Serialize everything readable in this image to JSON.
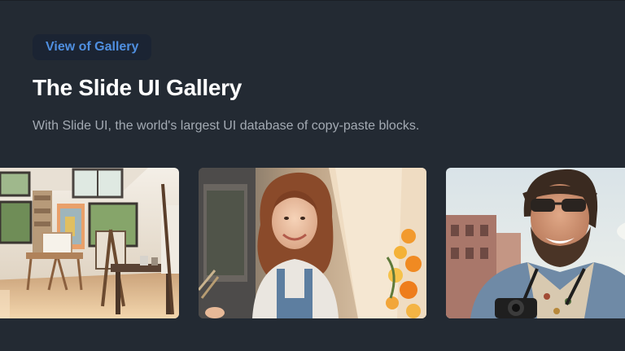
{
  "header": {
    "badge_label": "View of Gallery",
    "title": "The Slide UI Gallery",
    "subtitle": "With Slide UI, the world's largest UI database of copy-paste blocks."
  },
  "gallery": {
    "images": [
      {
        "name": "art-studio-image",
        "subject": "sunlit painter's studio with easels"
      },
      {
        "name": "smiling-woman-painter-image",
        "subject": "smiling woman with curly hair beside a canvas"
      },
      {
        "name": "smiling-man-camera-image",
        "subject": "smiling bearded man in sunglasses with a camera"
      }
    ]
  },
  "colors": {
    "background": "#232a33",
    "badge_bg": "#1b2433",
    "badge_text": "#4f8fe0",
    "title": "#ffffff",
    "subtitle": "#a3aab3"
  }
}
